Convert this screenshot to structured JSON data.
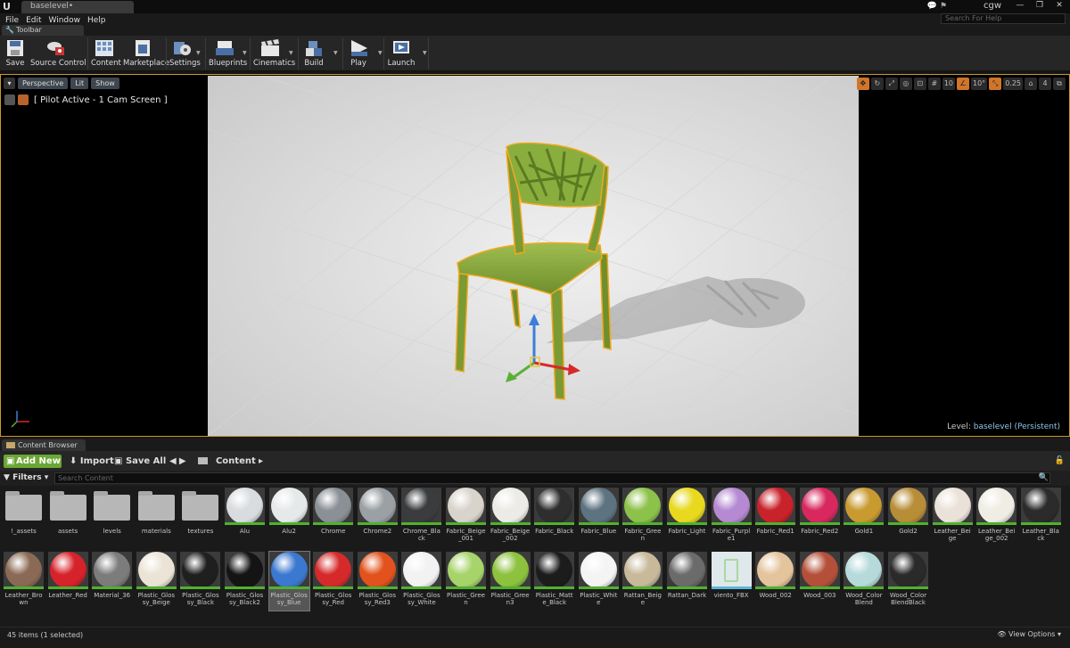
{
  "window": {
    "tab_title": "baselevel•",
    "user": "cgw",
    "help_search_placeholder": "Search For Help"
  },
  "menu": [
    "File",
    "Edit",
    "Window",
    "Help"
  ],
  "toolbar": {
    "tab_label": "Toolbar",
    "buttons": [
      {
        "label": "Save",
        "icon": "save-icon"
      },
      {
        "label": "Source Control",
        "icon": "source-control-icon"
      },
      {
        "label": "Content",
        "icon": "content-icon"
      },
      {
        "label": "Marketplace",
        "icon": "marketplace-icon"
      },
      {
        "label": "Settings",
        "icon": "settings-icon"
      },
      {
        "label": "Blueprints",
        "icon": "blueprints-icon"
      },
      {
        "label": "Cinematics",
        "icon": "cinematics-icon"
      },
      {
        "label": "Build",
        "icon": "build-icon"
      },
      {
        "label": "Play",
        "icon": "play-icon"
      },
      {
        "label": "Launch",
        "icon": "launch-icon"
      }
    ]
  },
  "viewport": {
    "perspective_label": "Perspective",
    "lit_label": "Lit",
    "show_label": "Show",
    "pilot_text": "[ Pilot Active - 1 Cam Screen ]",
    "grid_snap": "10",
    "rotation_snap": "10°",
    "scale_snap": "0.25",
    "camera_speed": "4",
    "level_prefix": "Level:",
    "level_name": "baselevel (Persistent)"
  },
  "content_browser": {
    "tab_label": "Content Browser",
    "add_new_label": "Add New",
    "import_label": "Import",
    "save_all_label": "Save All",
    "path_label": "Content",
    "filters_label": "Filters",
    "search_placeholder": "Search Content",
    "status_text": "45 items (1 selected)",
    "view_options_label": "View Options",
    "selected_index": 30,
    "items": [
      {
        "name": "!_assets",
        "kind": "folder"
      },
      {
        "name": "assets",
        "kind": "folder"
      },
      {
        "name": "levels",
        "kind": "folder"
      },
      {
        "name": "materials",
        "kind": "folder"
      },
      {
        "name": "textures",
        "kind": "folder"
      },
      {
        "name": "Alu",
        "color": "#d8dcdf"
      },
      {
        "name": "Alu2",
        "color": "#e6e9ea"
      },
      {
        "name": "Chrome",
        "color": "#8a9095"
      },
      {
        "name": "Chrome2",
        "color": "#9aa0a4"
      },
      {
        "name": "Chrome_Black",
        "color": "#3a3c3e"
      },
      {
        "name": "Fabric_Beige_001",
        "color": "#d9d4cb"
      },
      {
        "name": "Fabric_Beige_002",
        "color": "#ecebe7"
      },
      {
        "name": "Fabric_Black",
        "color": "#2e2e2e"
      },
      {
        "name": "Fabric_Blue",
        "color": "#5d7380"
      },
      {
        "name": "Fabric_Green",
        "color": "#8dc24a"
      },
      {
        "name": "Fabric_Light",
        "color": "#e8d91e"
      },
      {
        "name": "Fabric_Purple1",
        "color": "#b58ad2"
      },
      {
        "name": "Fabric_Red1",
        "color": "#c8222a"
      },
      {
        "name": "Fabric_Red2",
        "color": "#d8285f"
      },
      {
        "name": "Gold1",
        "color": "#c99a30"
      },
      {
        "name": "Gold2",
        "color": "#b88d38"
      },
      {
        "name": "Leather_Beige",
        "color": "#eae2d8"
      },
      {
        "name": "Leather_Beige_002",
        "color": "#efede4"
      },
      {
        "name": "Leather_Black",
        "color": "#2b2b2b"
      },
      {
        "name": "Leather_Brown",
        "color": "#8a6a55"
      },
      {
        "name": "Leather_Red",
        "color": "#d6222a"
      },
      {
        "name": "Material_36",
        "color": "#7c7c7c"
      },
      {
        "name": "Plastic_Glossy_Beige",
        "color": "#ebe4d6"
      },
      {
        "name": "Plastic_Glossy_Black",
        "color": "#1f1f1f"
      },
      {
        "name": "Plastic_Glossy_Black2",
        "color": "#141414"
      },
      {
        "name": "Plastic_Glossy_Blue",
        "color": "#3b78d0"
      },
      {
        "name": "Plastic_Glossy_Red",
        "color": "#d62a2a"
      },
      {
        "name": "Plastic_Glossy_Red3",
        "color": "#e2521c"
      },
      {
        "name": "Plastic_Glossy_White",
        "color": "#f2f2f2"
      },
      {
        "name": "Plastic_Green",
        "color": "#a7d46a"
      },
      {
        "name": "Plastic_Green3",
        "color": "#8cc23e"
      },
      {
        "name": "Plastic_Matte_Black",
        "color": "#1c1c1c"
      },
      {
        "name": "Plastic_White",
        "color": "#f4f4f4"
      },
      {
        "name": "Rattan_Beige",
        "color": "#c7b99a"
      },
      {
        "name": "Rattan_Dark",
        "color": "#6b6b6b"
      },
      {
        "name": "viento_FBX",
        "color": "#a8d8a0",
        "kind": "mesh"
      },
      {
        "name": "Wood_002",
        "color": "#e4c49c"
      },
      {
        "name": "Wood_003",
        "color": "#b4503a"
      },
      {
        "name": "Wood_Color Blend",
        "color": "#b6dadb"
      },
      {
        "name": "Wood_Color BlendBlack",
        "color": "#2a2a2a"
      }
    ]
  }
}
